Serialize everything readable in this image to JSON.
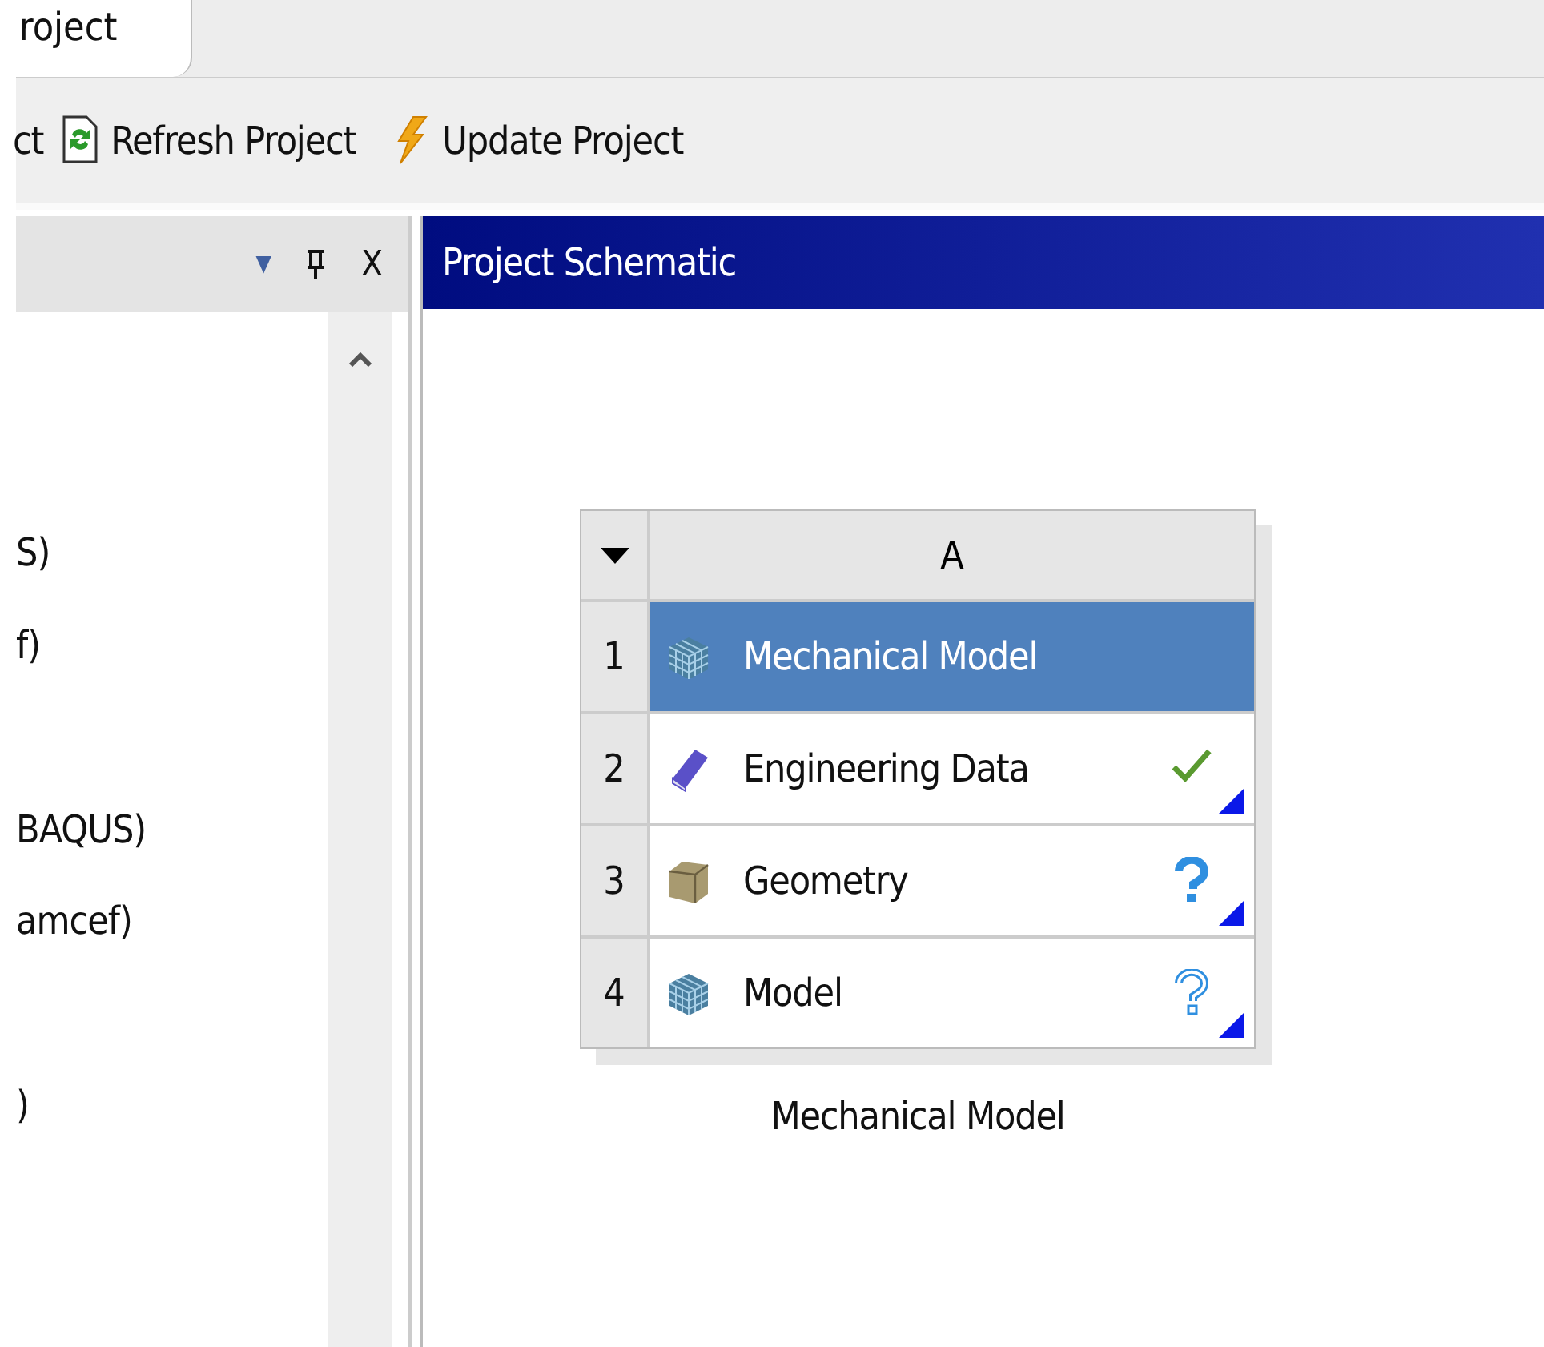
{
  "tabs": [
    {
      "label": "roject",
      "selected": true
    }
  ],
  "toolbar": [
    {
      "kind": "text",
      "label": "ct"
    },
    {
      "kind": "refresh",
      "label": "Refresh Project"
    },
    {
      "kind": "update",
      "label": "Update Project"
    }
  ],
  "toolbox": {
    "header_buttons": [
      "▼",
      "X"
    ],
    "groups": [
      {
        "items": [
          "S)",
          "f)"
        ]
      },
      {
        "items": [
          "BAQUS)",
          "amcef)"
        ]
      },
      {
        "items": [
          ")"
        ]
      }
    ]
  },
  "schematic": {
    "title": "Project Schematic",
    "system": {
      "column": "A",
      "caption": "Mechanical Model",
      "rows": [
        {
          "number": "1",
          "label": "Mechanical Model",
          "kind": "system",
          "selected": true
        },
        {
          "number": "2",
          "label": "Engineering Data",
          "kind": "data",
          "selected": false
        },
        {
          "number": "3",
          "label": "Geometry",
          "kind": "geometry",
          "selected": false
        },
        {
          "number": "4",
          "label": "Model",
          "kind": "model",
          "selected": false
        }
      ]
    }
  }
}
